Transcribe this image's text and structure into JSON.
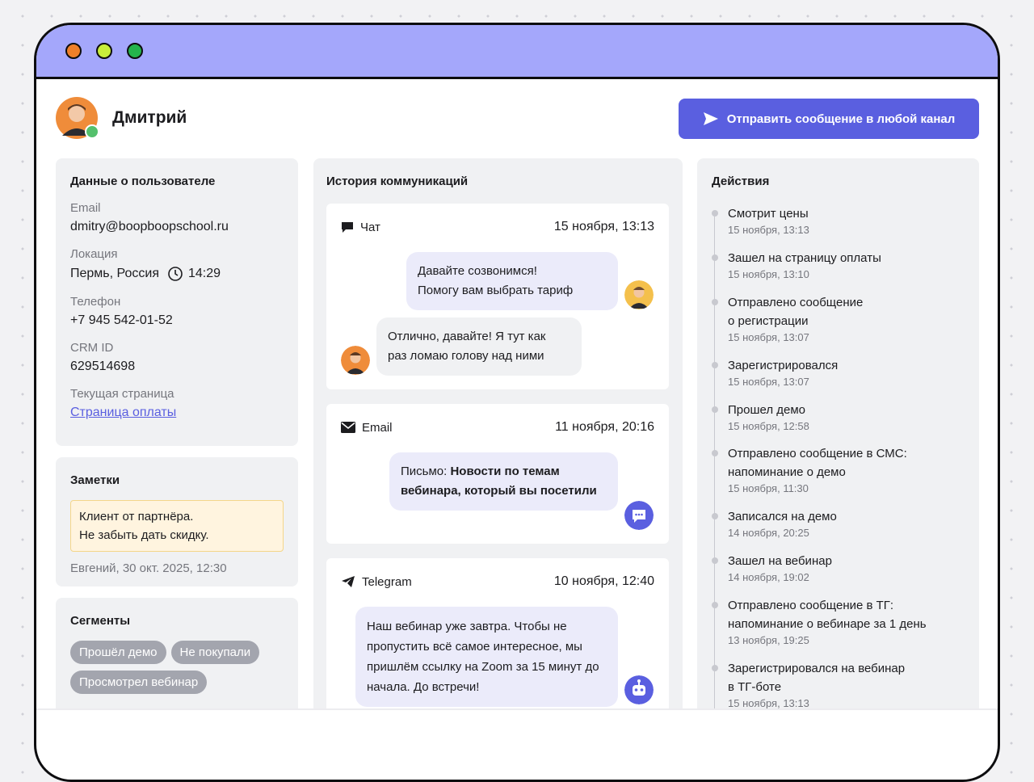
{
  "user": {
    "name": "Дмитрий"
  },
  "header": {
    "send_button": "Отправить сообщение в любой канал"
  },
  "info": {
    "title": "Данные о пользователе",
    "fields": [
      {
        "label": "Email",
        "value": "dmitry@boopboopschool.ru"
      },
      {
        "label": "Локация",
        "value": "Пермь, Россия",
        "time": "14:29"
      },
      {
        "label": "Телефон",
        "value": "+7 945 542-01-52"
      },
      {
        "label": "CRM ID",
        "value": "629514698"
      },
      {
        "label": "Текущая страница",
        "value": "Страница оплаты"
      }
    ]
  },
  "notes": {
    "title": "Заметки",
    "text_line1": "Клиент от партнёра.",
    "text_line2": "Не забыть дать скидку.",
    "meta": "Евгений, 30 окт. 2025, 12:30"
  },
  "segments": {
    "title": "Сегменты",
    "tags": [
      "Прошёл демо",
      "Не покупали",
      "Просмотрел вебинар"
    ]
  },
  "history": {
    "title": "История коммуникаций",
    "cards": [
      {
        "channel": "Чат",
        "date": "15 ноября, 13:13",
        "msg1_line1": "Давайте созвонимся!",
        "msg1_line2": "Помогу вам выбрать тариф",
        "msg2_line1": "Отлично, давайте! Я тут как",
        "msg2_line2": "раз ломаю голову над ними"
      },
      {
        "channel": "Email",
        "date": "11 ноября, 20:16",
        "prefix": "Письмо: ",
        "subject": "Новости по темам вебинара, который вы посетили"
      },
      {
        "channel": "Telegram",
        "date": "10 ноября, 12:40",
        "text": "Наш вебинар уже завтра. Чтобы не пропустить всё самое интересное, мы пришлём ссылку на Zoom за 15 минут до начала. До встречи!"
      }
    ]
  },
  "actions": {
    "title": "Действия",
    "items": [
      {
        "line1": "Смотрит цены",
        "line2": "",
        "time": "15 ноября, 13:13"
      },
      {
        "line1": "Зашел на страницу оплаты",
        "line2": "",
        "time": "15 ноября, 13:10"
      },
      {
        "line1": "Отправлено сообщение",
        "line2": "о регистрации",
        "time": "15 ноября, 13:07"
      },
      {
        "line1": "Зарегистрировался",
        "line2": "",
        "time": "15 ноября, 13:07"
      },
      {
        "line1": "Прошел демо",
        "line2": "",
        "time": "15 ноября, 12:58"
      },
      {
        "line1": "Отправлено сообщение в СМС:",
        "line2": "напоминание о демо",
        "time": "15 ноября, 11:30"
      },
      {
        "line1": "Записался на демо",
        "line2": "",
        "time": "14 ноября, 20:25"
      },
      {
        "line1": "Зашел на вебинар",
        "line2": "",
        "time": "14 ноября, 19:02"
      },
      {
        "line1": "Отправлено сообщение в ТГ:",
        "line2": "напоминание о вебинаре за 1 день",
        "time": "13 ноября, 19:25"
      },
      {
        "line1": "Зарегистрировался на вебинар",
        "line2": "в ТГ-боте",
        "time": "15 ноября, 13:13"
      }
    ]
  },
  "colors": {
    "titlebar": "#a4a7fb",
    "accent": "#5a5fe0",
    "dot_red": "#ef8028",
    "dot_yellow": "#c8ee3a",
    "dot_green": "#24b44c"
  }
}
